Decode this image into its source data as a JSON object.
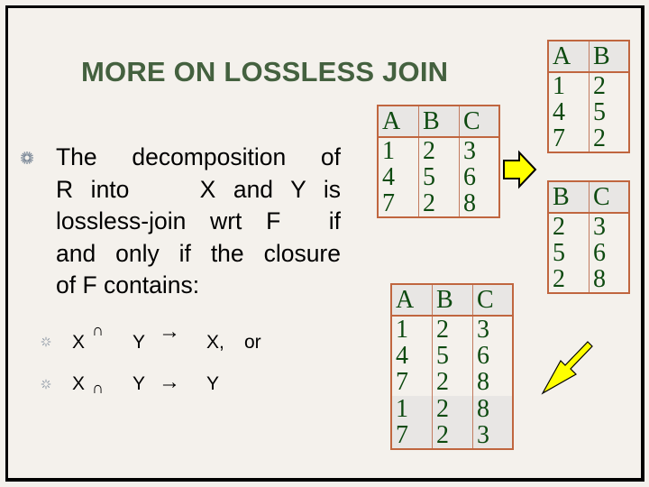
{
  "slide": {
    "title": "MORE ON LOSSLESS JOIN",
    "main_bullet": {
      "icon": "asterisk-bullet-icon",
      "lines": [
        "The decomposition of",
        "R into    X and Y is",
        "lossless-join wrt F  if",
        "and only if the closure",
        "of F contains:"
      ]
    },
    "sub_bullets": [
      {
        "icon": "asterisk-bullet-icon",
        "left": "X",
        "intersect": "∩",
        "middle": "Y",
        "arrow": "→",
        "right": "X,",
        "suffix": "or"
      },
      {
        "icon": "asterisk-bullet-icon",
        "left": "X",
        "intersect": "∩",
        "middle": "Y",
        "arrow": "→",
        "right": "Y",
        "suffix": ""
      }
    ],
    "relation_r": {
      "headers": [
        "A",
        "B",
        "C"
      ],
      "rows": [
        [
          "1",
          "2",
          "3"
        ],
        [
          "4",
          "5",
          "6"
        ],
        [
          "7",
          "2",
          "8"
        ]
      ]
    },
    "relation_x": {
      "headers": [
        "A",
        "B"
      ],
      "rows": [
        [
          "1",
          "2"
        ],
        [
          "4",
          "5"
        ],
        [
          "7",
          "2"
        ]
      ]
    },
    "relation_y": {
      "headers": [
        "B",
        "C"
      ],
      "rows": [
        [
          "2",
          "3"
        ],
        [
          "5",
          "6"
        ],
        [
          "2",
          "8"
        ]
      ]
    },
    "relation_join": {
      "headers": [
        "A",
        "B",
        "C"
      ],
      "rows": [
        [
          "1",
          "2",
          "3"
        ],
        [
          "4",
          "5",
          "6"
        ],
        [
          "7",
          "2",
          "8"
        ]
      ],
      "spurious_rows": [
        [
          "1",
          "2",
          "8"
        ],
        [
          "7",
          "2",
          "3"
        ]
      ]
    },
    "colors": {
      "title": "#44613f",
      "table_text": "#0d4a10",
      "table_border": "#c0663f",
      "arrow_fill": "#ffff00",
      "background": "#f4f1ec"
    }
  }
}
